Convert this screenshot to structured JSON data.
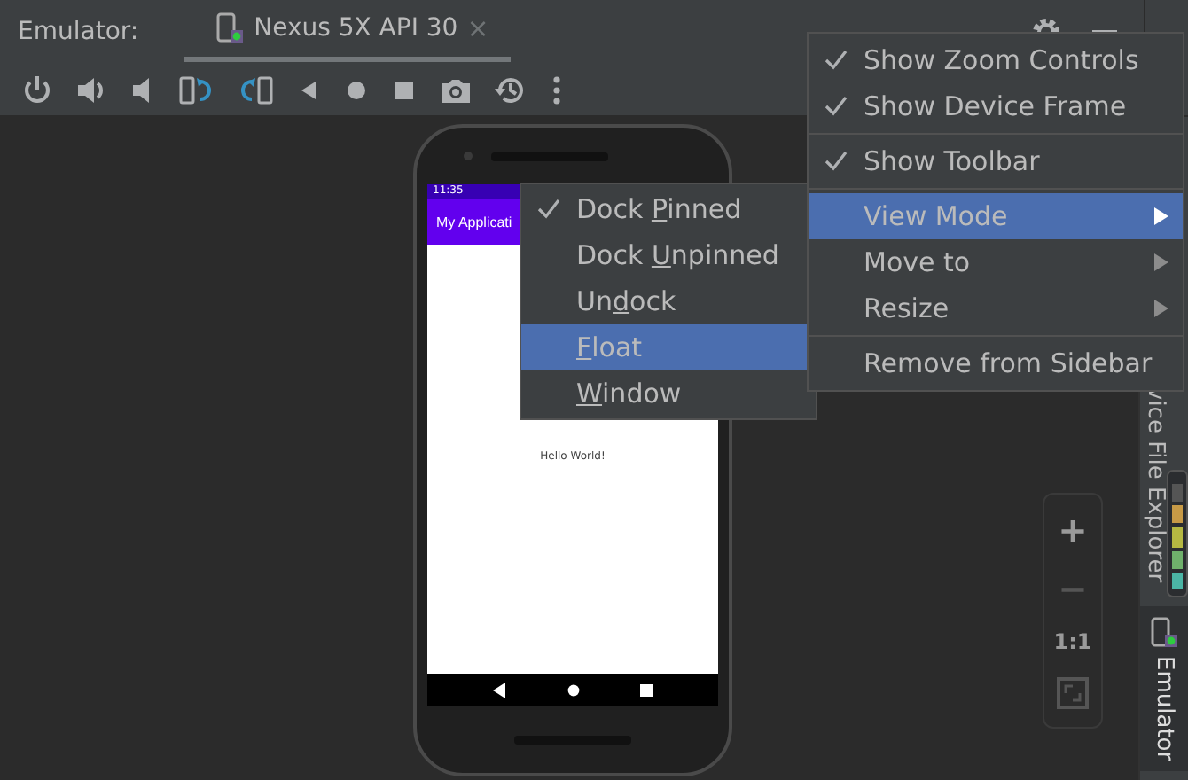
{
  "header": {
    "label": "Emulator:",
    "tab": {
      "title": "Nexus 5X API 30",
      "close": "×",
      "selected": true
    }
  },
  "device": {
    "status_time": "11:35",
    "app_title": "My Applicati",
    "content_text": "Hello World!"
  },
  "menu": {
    "items": [
      {
        "kind": "check",
        "label": "Show Zoom Controls",
        "checked": true,
        "selected": false
      },
      {
        "kind": "check",
        "label": "Show Device Frame",
        "checked": true,
        "selected": false
      },
      {
        "kind": "separator"
      },
      {
        "kind": "check",
        "label": "Show Toolbar",
        "checked": true,
        "selected": false
      },
      {
        "kind": "separator"
      },
      {
        "kind": "submenu",
        "label": "View Mode",
        "selected": true
      },
      {
        "kind": "submenu",
        "label": "Move to",
        "selected": false
      },
      {
        "kind": "submenu",
        "label": "Resize",
        "selected": false
      },
      {
        "kind": "separator"
      },
      {
        "kind": "plain",
        "label": "Remove from Sidebar",
        "selected": false
      }
    ]
  },
  "submenu": {
    "items": [
      {
        "before": "Dock ",
        "mnemonic": "P",
        "after": "inned",
        "checked": true,
        "selected": false
      },
      {
        "before": "Dock ",
        "mnemonic": "U",
        "after": "npinned",
        "checked": false,
        "selected": false
      },
      {
        "before": "Un",
        "mnemonic": "d",
        "after": "ock",
        "checked": false,
        "selected": false
      },
      {
        "mnemonic": "F",
        "after": "loat",
        "checked": false,
        "selected": true
      },
      {
        "mnemonic": "W",
        "after": "indow",
        "checked": false,
        "selected": false
      }
    ]
  },
  "zoom_controls": {
    "zoom_in": "+",
    "zoom_out": "−",
    "actual_size": "1:1"
  },
  "sidebar": {
    "tabs": [
      {
        "label": "vice File Explorer",
        "selected": false
      },
      {
        "label": "Emulator",
        "selected": true
      }
    ]
  }
}
